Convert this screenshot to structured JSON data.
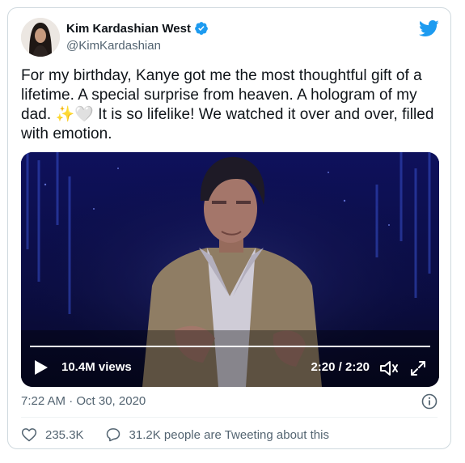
{
  "tweet": {
    "display_name": "Kim Kardashian West",
    "handle": "@KimKardashian",
    "text_part1": "For my birthday, Kanye got me the most thoughtful gift of a lifetime. A special surprise from heaven. A hologram of my dad. ",
    "emoji_sparkles": "✨",
    "emoji_heart": "🤍",
    "text_part2": " It is so lifelike! We watched it over and over, filled with emotion.",
    "timestamp": "7:22 AM · Oct 30, 2020"
  },
  "video": {
    "views": "10.4M views",
    "time": "2:20 / 2:20",
    "progress": 1.0
  },
  "actions": {
    "likes": "235.3K",
    "replies": "31.2K people are Tweeting about this"
  },
  "icons": {
    "verified": "verified-badge-icon",
    "brand": "twitter-bird-icon",
    "play": "play-icon",
    "volume": "volume-icon",
    "fullscreen": "fullscreen-icon",
    "info": "info-icon",
    "like": "heart-icon",
    "reply": "reply-icon"
  },
  "colors": {
    "accent": "#1d9bf0",
    "text": "#0f1419",
    "secondary": "#536471"
  }
}
